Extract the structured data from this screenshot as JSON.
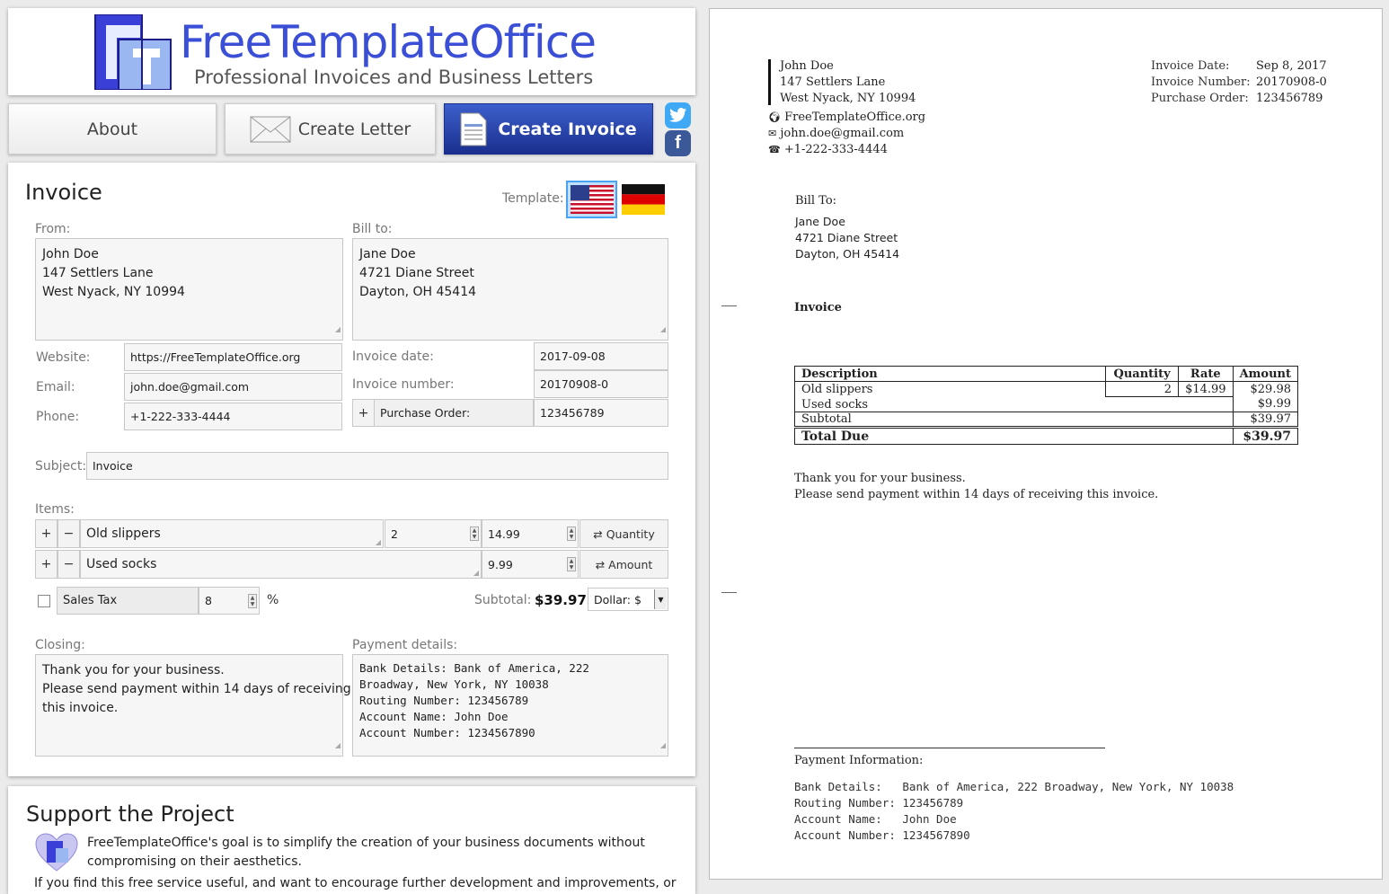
{
  "header": {
    "brand": "FreeTemplateOffice",
    "tagline": "Professional Invoices and Business Letters"
  },
  "nav": {
    "about": "About",
    "create_letter": "Create Letter",
    "create_invoice": "Create Invoice"
  },
  "form": {
    "title": "Invoice",
    "template_label": "Template:",
    "from_label": "From:",
    "from_lines": [
      "John Doe",
      "147 Settlers Lane",
      "West Nyack, NY 10994"
    ],
    "bill_to_label": "Bill to:",
    "bill_to_lines": [
      "Jane Doe",
      "4721 Diane Street",
      "Dayton, OH 45414"
    ],
    "website_label": "Website:",
    "website": "https://FreeTemplateOffice.org",
    "email_label": "Email:",
    "email": "john.doe@gmail.com",
    "phone_label": "Phone:",
    "phone": "+1-222-333-4444",
    "invoice_date_label": "Invoice date:",
    "invoice_date": "2017-09-08",
    "invoice_number_label": "Invoice number:",
    "invoice_number": "20170908-0",
    "po_label": "Purchase Order:",
    "po_value": "123456789",
    "subject_label": "Subject:",
    "subject": "Invoice",
    "items_label": "Items:",
    "items": [
      {
        "desc": "Old slippers",
        "qty": "2",
        "rate": "14.99",
        "toggle": "⇄ Quantity"
      },
      {
        "desc": "Used socks",
        "qty": "",
        "rate": "9.99",
        "toggle": "⇄ Amount"
      }
    ],
    "sales_tax_label": "Sales Tax",
    "sales_tax_value": "8",
    "percent": "%",
    "subtotal_label": "Subtotal:",
    "subtotal": "$39.97",
    "currency": "Dollar: $",
    "closing_label": "Closing:",
    "closing_lines": [
      "Thank you for your business.",
      "Please send payment within 14 days of receiving",
      "this invoice."
    ],
    "payment_label": "Payment details:",
    "payment_lines": [
      "Bank Details:   Bank of America, 222",
      "Broadway, New York, NY 10038",
      "Routing Number: 123456789",
      "Account Name:   John Doe",
      "Account Number: 1234567890"
    ]
  },
  "support": {
    "title": "Support the Project",
    "text1": "FreeTemplateOffice's goal is to simplify the creation of your business documents without",
    "text2": "compromising on their aesthetics.",
    "text3": "If you find this free service useful, and want to encourage further development and improvements, or"
  },
  "preview": {
    "sender_lines": [
      "John Doe",
      "147 Settlers Lane",
      "West Nyack, NY 10994"
    ],
    "website": "FreeTemplateOffice.org",
    "email": "john.doe@gmail.com",
    "phone": "+1-222-333-4444",
    "meta_labels": [
      "Invoice Date:",
      "Invoice Number:",
      "Purchase Order:"
    ],
    "meta_values": [
      "Sep 8, 2017",
      "20170908-0",
      "123456789"
    ],
    "bill_to_label": "Bill To:",
    "bill_to_lines": [
      "Jane Doe",
      "4721 Diane Street",
      "Dayton, OH 45414"
    ],
    "subject": "Invoice",
    "table_headers": [
      "Description",
      "Quantity",
      "Rate",
      "Amount"
    ],
    "rows": [
      {
        "desc": "Old slippers",
        "qty": "2",
        "rate": "$14.99",
        "amount": "$29.98"
      },
      {
        "desc": "Used socks",
        "qty": "",
        "rate": "",
        "amount": "$9.99"
      }
    ],
    "subtotal_label": "Subtotal",
    "subtotal": "$39.97",
    "total_label": "Total Due",
    "total": "$39.97",
    "closing_lines": [
      "Thank you for your business.",
      "Please send payment within 14 days of receiving this invoice."
    ],
    "payment_title": "Payment Information:",
    "payment_lines": [
      "Bank Details:   Bank of America, 222 Broadway, New York, NY 10038",
      "Routing Number: 123456789",
      "Account Name:   John Doe",
      "Account Number: 1234567890"
    ]
  }
}
